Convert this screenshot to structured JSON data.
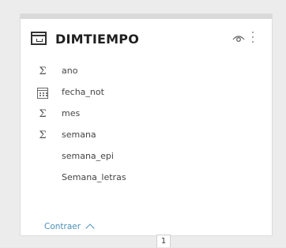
{
  "table": {
    "title": "DIMTIEMPO",
    "icons": {
      "table": "table-icon",
      "visibility": "eye-icon",
      "more": "more-options-icon"
    },
    "fields": [
      {
        "name": "ano",
        "icon": "sigma-icon"
      },
      {
        "name": "fecha_not",
        "icon": "calendar-icon"
      },
      {
        "name": "mes",
        "icon": "sigma-icon"
      },
      {
        "name": "semana",
        "icon": "sigma-icon"
      },
      {
        "name": "semana_epi",
        "icon": ""
      },
      {
        "name": "Semana_letras",
        "icon": ""
      }
    ],
    "collapse_label": "Contraer"
  },
  "page_indicator": "1",
  "colors": {
    "link": "#4a90b8",
    "card": "#ffffff",
    "background": "#ececec"
  }
}
